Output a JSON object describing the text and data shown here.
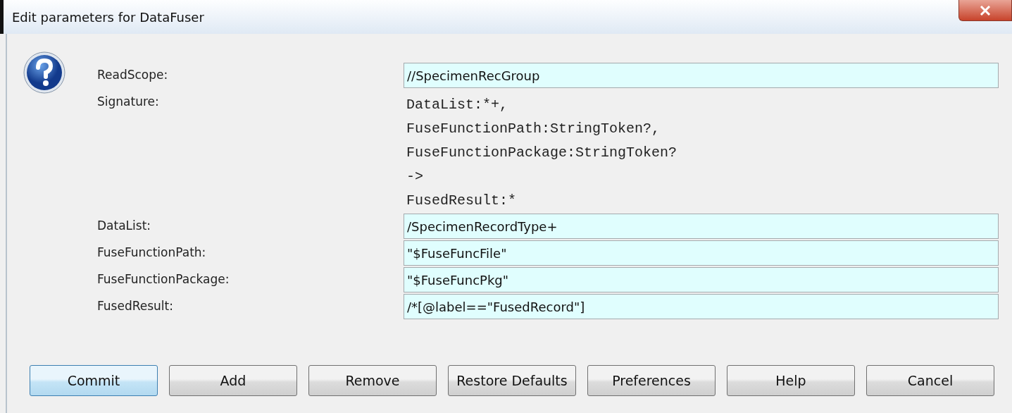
{
  "window": {
    "title": "Edit parameters for DataFuser"
  },
  "params": [
    {
      "kind": "field",
      "label": "ReadScope:",
      "value": "//SpecimenRecGroup"
    },
    {
      "kind": "signature",
      "label": "Signature:",
      "lines": [
        "DataList:*+,",
        "FuseFunctionPath:StringToken?,",
        "FuseFunctionPackage:StringToken?",
        "->",
        "FusedResult:*"
      ]
    },
    {
      "kind": "field",
      "label": "DataList:",
      "value": "/SpecimenRecordType+"
    },
    {
      "kind": "field",
      "label": "FuseFunctionPath:",
      "value": "\"$FuseFuncFile\""
    },
    {
      "kind": "field",
      "label": "FuseFunctionPackage:",
      "value": "\"$FuseFuncPkg\""
    },
    {
      "kind": "field",
      "label": "FusedResult:",
      "value": "/*[@label==\"FusedRecord\"]"
    }
  ],
  "buttons": [
    {
      "label": "Commit",
      "default": true
    },
    {
      "label": "Add",
      "default": false
    },
    {
      "label": "Remove",
      "default": false
    },
    {
      "label": "Restore Defaults",
      "default": false
    },
    {
      "label": "Preferences",
      "default": false
    },
    {
      "label": "Help",
      "default": false
    },
    {
      "label": "Cancel",
      "default": false
    }
  ]
}
